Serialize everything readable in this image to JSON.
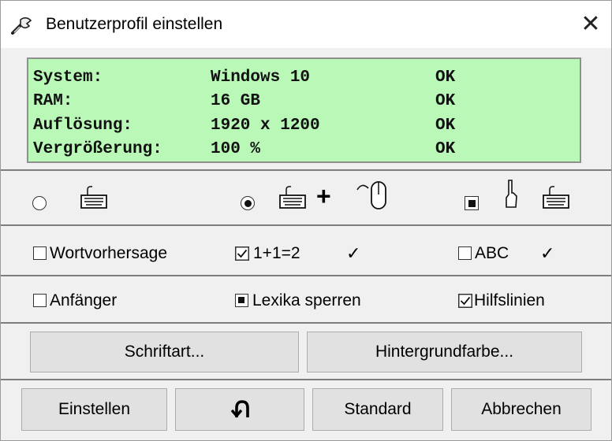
{
  "window": {
    "title": "Benutzerprofil einstellen",
    "close_glyph": "✕",
    "title_icon": "wrench-icon"
  },
  "system": {
    "rows": [
      {
        "label": "System:",
        "value": "Windows 10",
        "status": "OK"
      },
      {
        "label": "RAM:",
        "value": "16 GB",
        "status": "OK"
      },
      {
        "label": "Auflösung:",
        "value": "1920 x 1200",
        "status": "OK"
      },
      {
        "label": "Vergrößerung:",
        "value": "100 %",
        "status": "OK"
      }
    ],
    "background": "#b9f8b7"
  },
  "input_modes": [
    {
      "icons": [
        "keyboard-icon"
      ],
      "selected": false
    },
    {
      "icons": [
        "keyboard-icon",
        "mouse-icon"
      ],
      "joiner": "+",
      "selected": true
    },
    {
      "icons": [
        "pointing-hand-icon",
        "keyboard-icon"
      ],
      "selected": "indeterminate"
    }
  ],
  "options_row1": {
    "wortvorhersage": {
      "label": "Wortvorhersage",
      "state": "unchecked"
    },
    "math": {
      "label": "1+1=2",
      "state": "checked",
      "mark": "✓"
    },
    "abc": {
      "label": "ABC",
      "state": "unchecked",
      "mark": "✓"
    }
  },
  "options_row2": {
    "anfaenger": {
      "label": "Anfänger",
      "state": "unchecked"
    },
    "lexika": {
      "label": "Lexika sperren",
      "state": "indeterminate"
    },
    "hilfslinien": {
      "label": "Hilfslinien",
      "state": "checked"
    }
  },
  "buttons": {
    "schriftart": "Schriftart...",
    "hintergrund": "Hintergrundfarbe...",
    "einstellen": "Einstellen",
    "undo_icon": "undo-arrow-icon",
    "standard": "Standard",
    "abbrechen": "Abbrechen"
  }
}
